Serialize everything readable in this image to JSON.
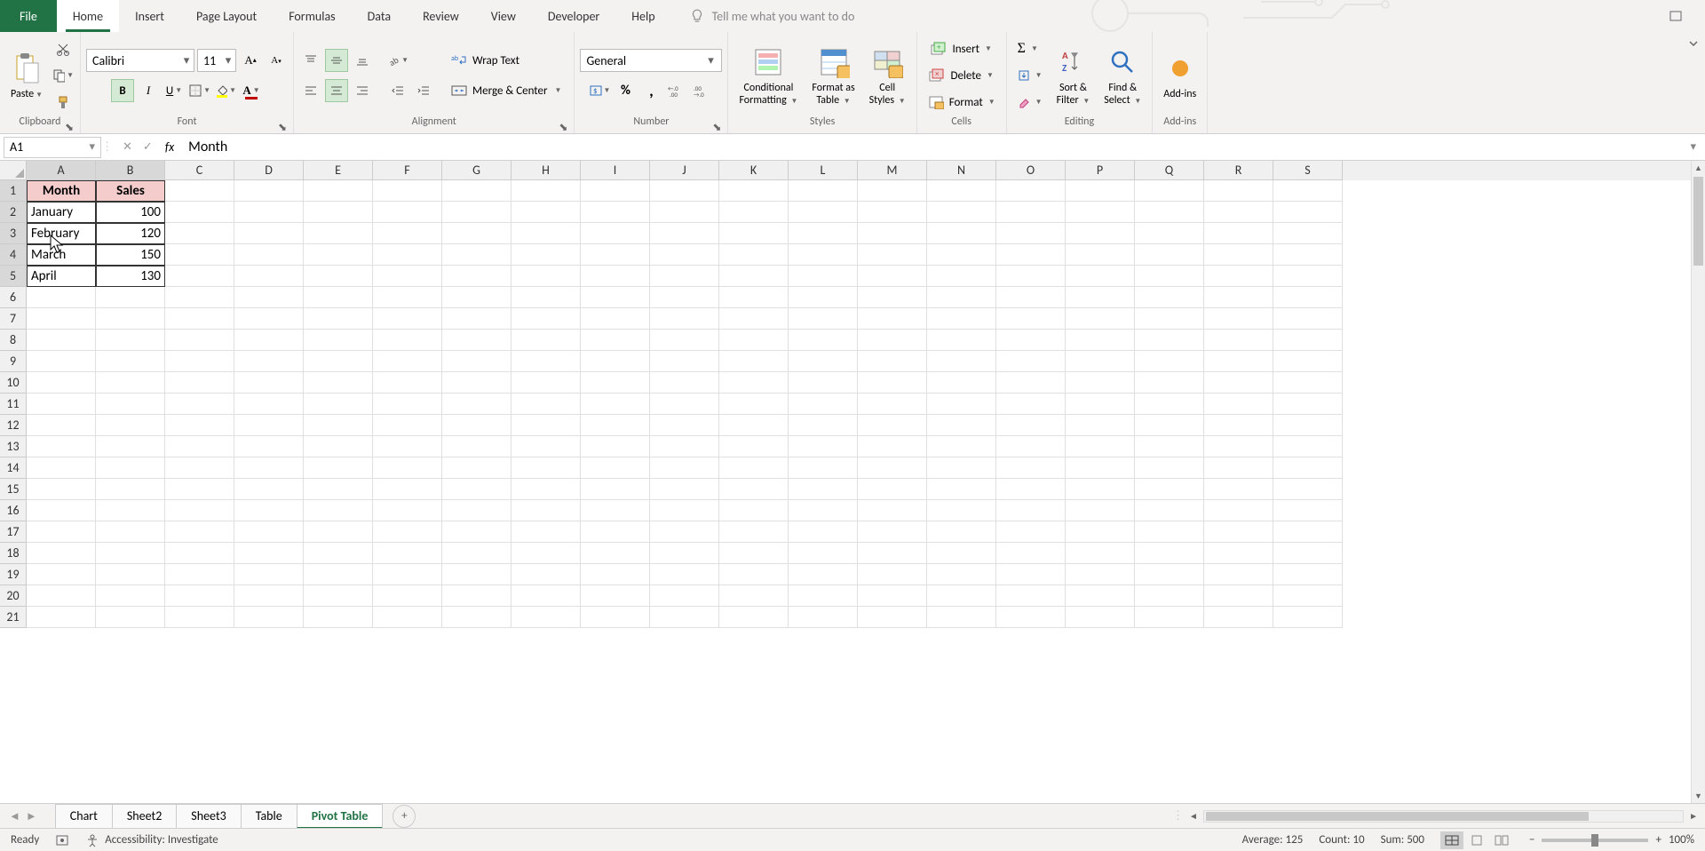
{
  "tabs": {
    "file": "File",
    "items": [
      "Home",
      "Insert",
      "Page Layout",
      "Formulas",
      "Data",
      "Review",
      "View",
      "Developer",
      "Help"
    ],
    "active": "Home",
    "tell_me": "Tell me what you want to do"
  },
  "ribbon": {
    "clipboard": {
      "label": "Clipboard",
      "paste": "Paste"
    },
    "font": {
      "label": "Font",
      "name": "Calibri",
      "size": "11"
    },
    "alignment": {
      "label": "Alignment",
      "wrap": "Wrap Text",
      "merge": "Merge & Center"
    },
    "number": {
      "label": "Number",
      "format": "General"
    },
    "styles": {
      "label": "Styles",
      "conditional": "Conditional\nFormatting",
      "formatas": "Format as\nTable",
      "cellstyles": "Cell\nStyles"
    },
    "cells": {
      "label": "Cells",
      "insert": "Insert",
      "delete": "Delete",
      "format": "Format"
    },
    "editing": {
      "label": "Editing",
      "sortfilter": "Sort &\nFilter",
      "findselect": "Find &\nSelect"
    },
    "addins": {
      "label": "Add-ins",
      "addins": "Add-ins"
    }
  },
  "formulaBar": {
    "nameBox": "A1",
    "formula": "Month"
  },
  "columns": [
    "A",
    "B",
    "C",
    "D",
    "E",
    "F",
    "G",
    "H",
    "I",
    "J",
    "K",
    "L",
    "M",
    "N",
    "O",
    "P",
    "Q",
    "R",
    "S"
  ],
  "rowsCount": 21,
  "tableData": {
    "headers": [
      "Month",
      "Sales"
    ],
    "rows": [
      {
        "m": "January",
        "s": "100"
      },
      {
        "m": "February",
        "s": "120"
      },
      {
        "m": "March",
        "s": "150"
      },
      {
        "m": "April",
        "s": "130"
      }
    ]
  },
  "sheetTabs": {
    "items": [
      "Chart",
      "Sheet2",
      "Sheet3",
      "Table",
      "Pivot Table"
    ],
    "active": "Pivot Table"
  },
  "statusBar": {
    "ready": "Ready",
    "accessibility": "Accessibility: Investigate",
    "average": "Average: 125",
    "count": "Count: 10",
    "sum": "Sum: 500",
    "zoom": "100%"
  }
}
